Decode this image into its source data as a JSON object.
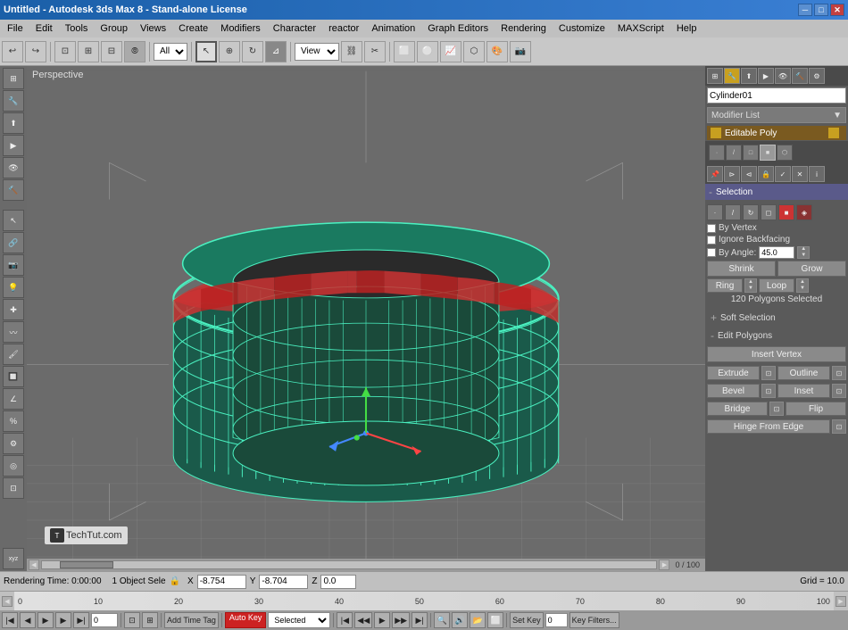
{
  "title_bar": {
    "title": "Untitled - Autodesk 3ds Max 8 - Stand-alone License",
    "btn_min": "─",
    "btn_max": "□",
    "btn_close": "✕"
  },
  "menu_bar": {
    "items": [
      "File",
      "Edit",
      "Tools",
      "Group",
      "Views",
      "Create",
      "Modifiers",
      "Character",
      "reactor",
      "Animation",
      "Graph Editors",
      "Rendering",
      "Customize",
      "MAXScript",
      "Help"
    ]
  },
  "toolbar": {
    "mode_dropdown": "All",
    "view_dropdown": "View"
  },
  "viewport": {
    "label": "Perspective"
  },
  "right_panel": {
    "object_name": "Cylinder01",
    "modifier_list": "Modifier List",
    "editable_poly": "Editable Poly",
    "tabs": {
      "icons": [
        "▲",
        "⟳",
        "⊞",
        "◈",
        "≡"
      ]
    },
    "selection": {
      "header": "Selection",
      "icons": [
        "·",
        "·",
        "⟳",
        "◻",
        "■",
        "◈"
      ],
      "by_vertex": "By Vertex",
      "ignore_backfacing": "Ignore Backfacing",
      "by_angle_label": "By Angle:",
      "by_angle_value": "45.0",
      "shrink_btn": "Shrink",
      "grow_btn": "Grow",
      "ring_label": "Ring",
      "loop_label": "Loop",
      "poly_count": "120 Polygons Selected"
    },
    "soft_selection": {
      "header": "Soft Selection"
    },
    "edit_polygons": {
      "header": "Edit Polygons",
      "insert_vertex": "Insert Vertex",
      "extrude": "Extrude",
      "outline": "Outline",
      "bevel": "Bevel",
      "inset": "Inset",
      "bridge": "Bridge",
      "flip": "Flip",
      "hinge_from_edge": "Hinge From Edge"
    }
  },
  "status_bar": {
    "object_select": "1 Object Sele",
    "x_label": "X",
    "x_value": "-8.754",
    "y_label": "Y",
    "y_value": "-8.704",
    "z_label": "Z",
    "z_value": "0.0",
    "grid_label": "Grid = 10.0",
    "rendering": "Rendering Time: 0:00:00"
  },
  "timeline": {
    "position": "0 / 100",
    "markers": [
      "0",
      "10",
      "20",
      "30",
      "40",
      "50",
      "60",
      "70",
      "80",
      "90",
      "100"
    ]
  },
  "bottom_toolbar": {
    "add_time_tag": "Add Time Tag",
    "auto_key": "Auto Key",
    "selected_label": "Selected",
    "set_key_label": "Set Key",
    "key_filters_label": "Key Filters...",
    "frame_value": "0"
  },
  "watermark": {
    "text": "TechTut.com"
  }
}
